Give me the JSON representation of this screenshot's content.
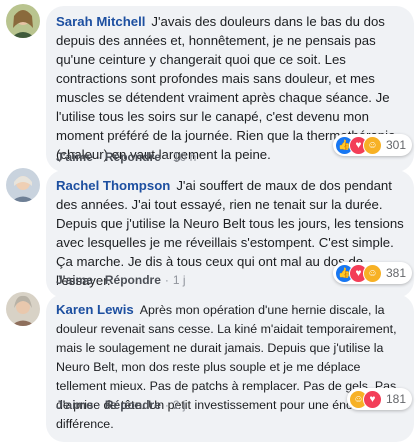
{
  "comments": [
    {
      "author": "Sarah Mitchell",
      "text": "J'avais des douleurs dans le bas du dos depuis des années et, honnêtement, je ne pensais pas qu'une ceinture y changerait quoi que ce soit. Les contractions sont profondes mais sans douleur, et mes muscles se détendent vraiment après chaque séance. Je l'utilise tous les soirs sur le canapé, c'est devenu mon moment préféré de la journée. Rien que la thermothérapie (chaleur) en vaut largement la peine.",
      "like_label": "J'aime",
      "reply_label": "Répondre",
      "time": "10 h",
      "reaction_icons": [
        "like-icon",
        "love-icon",
        "haha-icon"
      ],
      "reaction_count": "301"
    },
    {
      "author": "Rachel Thompson",
      "text": "J'ai souffert de maux de dos pendant des années. J'ai tout essayé, rien ne tenait sur la durée. Depuis que j'utilise la Neuro Belt tous les jours, les tensions avec lesquelles je me réveillais s'estompent. C'est simple. Ça marche. Je dis à tous ceux qui ont mal au dos de l'essayer.",
      "like_label": "J'aime",
      "reply_label": "Répondre",
      "time": "1 j",
      "reaction_icons": [
        "like-icon",
        "love-icon",
        "haha-icon"
      ],
      "reaction_count": "381"
    },
    {
      "author": "Karen Lewis",
      "text": "Après mon opération d'une hernie discale, la douleur revenait sans cesse. La kiné m'aidait temporairement, mais le soulagement ne durait jamais. Depuis que j'utilise la Neuro Belt, mon dos reste plus souple et je me déplace tellement mieux. Pas de patchs à remplacer. Pas de gels. Pas de prise de tête. Un petit investissement pour une énorme différence.",
      "like_label": "J'aime",
      "reply_label": "Répondre",
      "time": "2 j",
      "reaction_icons": [
        "care-icon",
        "love-icon"
      ],
      "reaction_count": "181"
    }
  ]
}
